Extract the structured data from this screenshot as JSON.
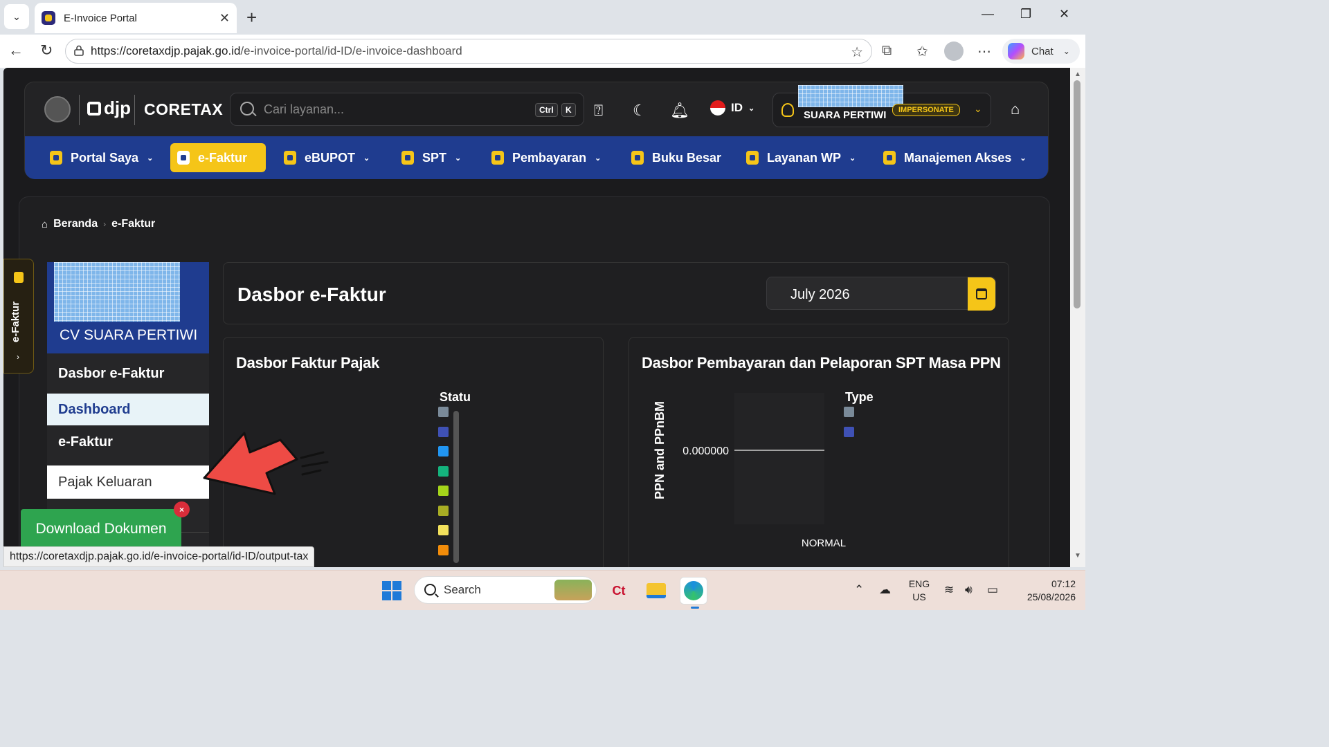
{
  "browser": {
    "tab_title": "E-Invoice Portal",
    "url_host": "https://coretaxdjp.pajak.go.id",
    "url_path": "/e-invoice-portal/id-ID/e-invoice-dashboard",
    "chat_label": "Chat",
    "status_url": "https://coretaxdjp.pajak.go.id/e-invoice-portal/id-ID/output-tax"
  },
  "header": {
    "brand_djp": "djp",
    "brand_coretax": "CORETAX",
    "search_placeholder": "Cari layanan...",
    "kbd_ctrl": "Ctrl",
    "kbd_k": "K",
    "language": "ID",
    "user_name": "SUARA PERTIWI",
    "impersonate_badge": "IMPERSONATE"
  },
  "nav": {
    "items": [
      {
        "label": "Portal Saya",
        "has_menu": true
      },
      {
        "label": "e-Faktur",
        "has_menu": false,
        "active": true
      },
      {
        "label": "eBUPOT",
        "has_menu": true
      },
      {
        "label": "SPT",
        "has_menu": true
      },
      {
        "label": "Pembayaran",
        "has_menu": true
      },
      {
        "label": "Buku Besar",
        "has_menu": false
      },
      {
        "label": "Layanan WP",
        "has_menu": true
      },
      {
        "label": "Manajemen Akses",
        "has_menu": true
      }
    ]
  },
  "breadcrumb": {
    "home": "Beranda",
    "current": "e-Faktur"
  },
  "sidebar": {
    "company": "CV SUARA PERTIWI",
    "items": [
      {
        "label": "Dasbor e-Faktur",
        "style": "header"
      },
      {
        "label": "Dashboard",
        "style": "selected"
      },
      {
        "label": "e-Faktur",
        "style": "header"
      },
      {
        "label": "Pajak Keluaran",
        "style": "link"
      }
    ]
  },
  "main": {
    "title": "Dasbor e-Faktur",
    "period": "July 2026"
  },
  "panel_faktur": {
    "title": "Dasbor Faktur Pajak",
    "legend_title": "Statu",
    "legend_colors": [
      "#7a8a99",
      "#3f51b5",
      "#2196f3",
      "#14b37d",
      "#a4d41a",
      "#a8ad24",
      "#f2e15c",
      "#f28c0a"
    ]
  },
  "panel_spt": {
    "title": "Dasbor Pembayaran dan Pelaporan SPT Masa PPN",
    "legend_title": "Type",
    "legend_colors": [
      "#7a8a99",
      "#3f51b5"
    ]
  },
  "chart_data": {
    "type": "bar",
    "title": "Dasbor Pembayaran dan Pelaporan SPT Masa PPN",
    "categories": [
      "NORMAL"
    ],
    "ylabel": "PPN and PPnBM",
    "xlabel": "",
    "y_tick_labels": [
      "0.000000"
    ],
    "series": [
      {
        "values": [
          0
        ]
      },
      {
        "values": [
          0
        ]
      }
    ],
    "legend_title": "Type",
    "legend_position": "right"
  },
  "side_tab": {
    "label": "e-Faktur"
  },
  "download": {
    "label": "Download Dokumen",
    "close": "×"
  },
  "taskbar": {
    "search_label": "Search",
    "lang_top": "ENG",
    "lang_bottom": "US",
    "time": "07:12",
    "date": "25/08/2026"
  }
}
